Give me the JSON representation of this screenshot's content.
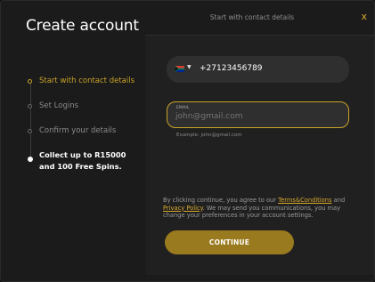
{
  "title": "Create account",
  "header": {
    "title": "Start with contact details",
    "close_label": "x"
  },
  "steps": [
    {
      "label": "Start with contact details",
      "state": "active"
    },
    {
      "label": "Set Logins",
      "state": "pending"
    },
    {
      "label": "Confirm your details",
      "state": "pending"
    },
    {
      "label": "Collect up to R15000 and 100 Free Spins.",
      "state": "final"
    }
  ],
  "phone": {
    "country": "South Africa",
    "value": "+27123456789"
  },
  "email": {
    "label": "EMAIL",
    "placeholder": "john@gmail.com",
    "example": "Example: john@gmail.com"
  },
  "terms": {
    "prefix": "By clicking continue, you agree to our ",
    "link1": "Terms&Conditions",
    "middle": " and ",
    "link2": "Privacy Policy",
    "suffix": ". We may send you communications, you may change your preferences in your account settings."
  },
  "continue_label": "CONTINUE",
  "colors": {
    "accent": "#c9a227",
    "button": "#9a7a1e",
    "background": "#1b1b1b",
    "panel": "#202020",
    "field": "#2f2f2f"
  }
}
